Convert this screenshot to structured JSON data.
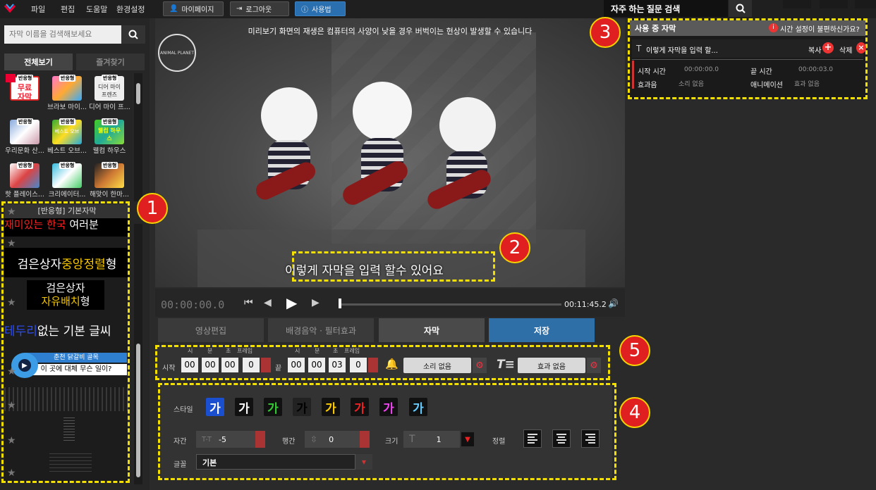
{
  "menu": {
    "file": "파일",
    "edit": "편집",
    "help": "도움말",
    "settings": "환경설정",
    "mypage": "마이페이지",
    "logout": "로그아웃",
    "howto": "사용법"
  },
  "faq": {
    "value": "자주 하는 질문 검색"
  },
  "left": {
    "search_placeholder": "자막 이름을 검색해보세요",
    "tab_all": "전체보기",
    "tab_fav": "즐겨찾기",
    "thumbs": [
      {
        "badge": "반응형",
        "label": "무료 자막",
        "cap": ""
      },
      {
        "badge": "반응형",
        "label": "",
        "cap": "브라보 마이..."
      },
      {
        "badge": "반응형",
        "label": "디어 마이 프렌즈",
        "cap": "디어 마이 프..."
      },
      {
        "badge": "반응형",
        "label": "",
        "cap": "우리문화 산..."
      },
      {
        "badge": "반응형",
        "label": "베스트 오브",
        "cap": "베스트 오브..."
      },
      {
        "badge": "반응형",
        "label": "웰컴 하우스",
        "cap": "웰컴 하우스"
      },
      {
        "badge": "반응형",
        "label": "",
        "cap": "핫 플레이스..."
      },
      {
        "badge": "반응형",
        "label": "",
        "cap": "크리에이터..."
      },
      {
        "badge": "반응형",
        "label": "",
        "cap": "해맞이 한마..."
      }
    ],
    "styles": {
      "header": "[반응형] 기본자막",
      "s1_a": "재미있는 ",
      "s1_b": "한국",
      "s1_c": " 여러분",
      "s2_a": "검은상자 ",
      "s2_b": "중앙정렬",
      "s2_c": "형",
      "s3_a": "검은상자",
      "s3_b": "자유배치",
      "s3_c": "형",
      "s4_a": "테두리",
      "s4_b": " 없는 기본 글씨",
      "s5_a": "춘천 닭갈비 골목",
      "s5_b": "이 곳에 대체 무슨 일이?"
    }
  },
  "video": {
    "notice": "미리보기 화면의 재생은 컴퓨터의 사양이 낮을 경우 버벅이는 현상이 발생할 수 있습니다",
    "caption": "이렇게 자막을 입력 할수 있어요",
    "current_time": "00:00:00.0",
    "total_time": "00:11:45.2",
    "logo_text": "ANIMAL PLANET"
  },
  "tabs": {
    "video_edit": "영상편집",
    "bgm": "배경음악 · 필터효과",
    "subtitle": "자막",
    "save": "저장"
  },
  "timing": {
    "label_h": "시",
    "label_m": "분",
    "label_s": "초",
    "label_f": "프레임",
    "start": "시작",
    "end": "끝",
    "sh": "00",
    "sm": "00",
    "ss": "00",
    "sf": "0",
    "eh": "00",
    "em": "00",
    "es": "03",
    "ef": "0",
    "sound": "소리 없음",
    "effect": "효과 없음"
  },
  "style": {
    "label": "스타일",
    "swatch": "가",
    "spacing_label": "자간",
    "spacing_icon": "T-T",
    "spacing_value": "-5",
    "line_label": "행간",
    "line_value": "0",
    "size_label": "크기",
    "size_value": "1",
    "align_label": "정렬",
    "font_label": "글꼴",
    "font_value": "기본"
  },
  "right": {
    "header": "사용 중 자막",
    "warning": "시간 설정이 불편하신가요?",
    "item_text": "이렇게 자막을 입력 할...",
    "copy": "복사",
    "delete": "삭제",
    "start_label": "시작 시간",
    "start_val": "00:00:00.0",
    "end_label": "끝 시간",
    "end_val": "00:00:03.0",
    "sound_label": "효과음",
    "sound_val": "소리 없음",
    "anim_label": "애니메이션",
    "anim_val": "효과 없음"
  },
  "markers": [
    "1",
    "2",
    "3",
    "4",
    "5"
  ],
  "colors": {
    "accent_yellow": "#f3e000",
    "marker_red": "#e02020",
    "save_blue": "#2f6fa8"
  }
}
